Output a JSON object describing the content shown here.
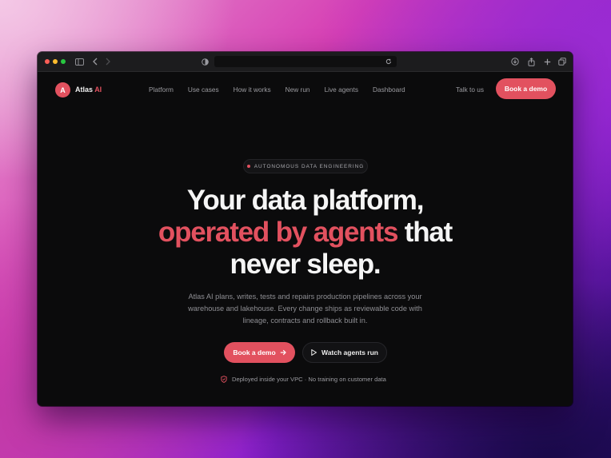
{
  "nav": {
    "logo_letter": "A",
    "brand_name": "Atlas",
    "brand_accent": "AI",
    "links": [
      "Platform",
      "Use cases",
      "How it works",
      "New run",
      "Live agents",
      "Dashboard"
    ],
    "talk_label": "Talk to us",
    "cta_label": "Book a demo"
  },
  "hero": {
    "eyebrow": "AUTONOMOUS DATA ENGINEERING",
    "headline_line1": "Your data platform,",
    "headline_highlight": "operated by agents",
    "headline_after_highlight": " that",
    "headline_line3": "never sleep.",
    "subtitle": "Atlas AI plans, writes, tests and repairs production pipelines across your warehouse and lakehouse. Every change ships as reviewable code with lineage, contracts and rollback built in.",
    "primary_cta": "Book a demo",
    "secondary_cta": "Watch agents run",
    "trust_note": "Deployed inside your VPC · No training on customer data"
  },
  "colors": {
    "accent": "#e2515f",
    "background": "#0b0b0c",
    "text": "#f5f5f5",
    "muted": "#8f8f94"
  },
  "icons": [
    "sidebar-icon",
    "back-icon",
    "forward-icon",
    "shield-icon",
    "reload-icon",
    "download-icon",
    "share-icon",
    "plus-icon",
    "tabs-icon",
    "arrow-right-icon",
    "play-icon",
    "shield-check-icon"
  ]
}
